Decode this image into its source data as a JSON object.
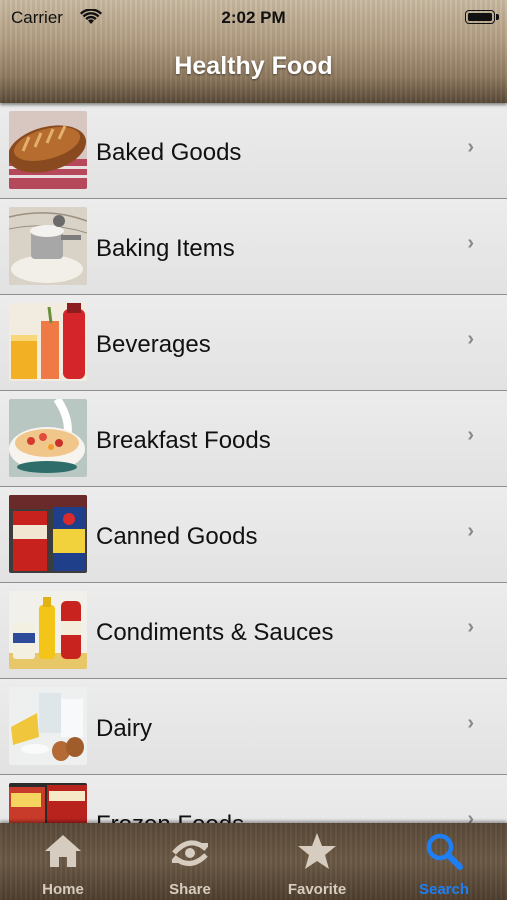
{
  "status_bar": {
    "carrier": "Carrier",
    "time": "2:02 PM"
  },
  "nav": {
    "title": "Healthy Food"
  },
  "categories": [
    {
      "label": "Baked Goods",
      "icon": "bread-thumbnail"
    },
    {
      "label": "Baking Items",
      "icon": "flour-thumbnail"
    },
    {
      "label": "Beverages",
      "icon": "drinks-thumbnail"
    },
    {
      "label": "Breakfast Foods",
      "icon": "cereal-thumbnail"
    },
    {
      "label": "Canned Goods",
      "icon": "cans-thumbnail"
    },
    {
      "label": "Condiments & Sauces",
      "icon": "condiments-thumbnail"
    },
    {
      "label": "Dairy",
      "icon": "dairy-thumbnail"
    },
    {
      "label": "Frozen Foods",
      "icon": "frozen-thumbnail"
    }
  ],
  "tabs": [
    {
      "label": "Home",
      "icon": "home-icon"
    },
    {
      "label": "Share",
      "icon": "share-icon"
    },
    {
      "label": "Favorite",
      "icon": "star-icon"
    },
    {
      "label": "Search",
      "icon": "search-icon",
      "active": true
    }
  ],
  "colors": {
    "accent": "#1e7ff5",
    "tab_inactive": "#d6ccbf"
  }
}
